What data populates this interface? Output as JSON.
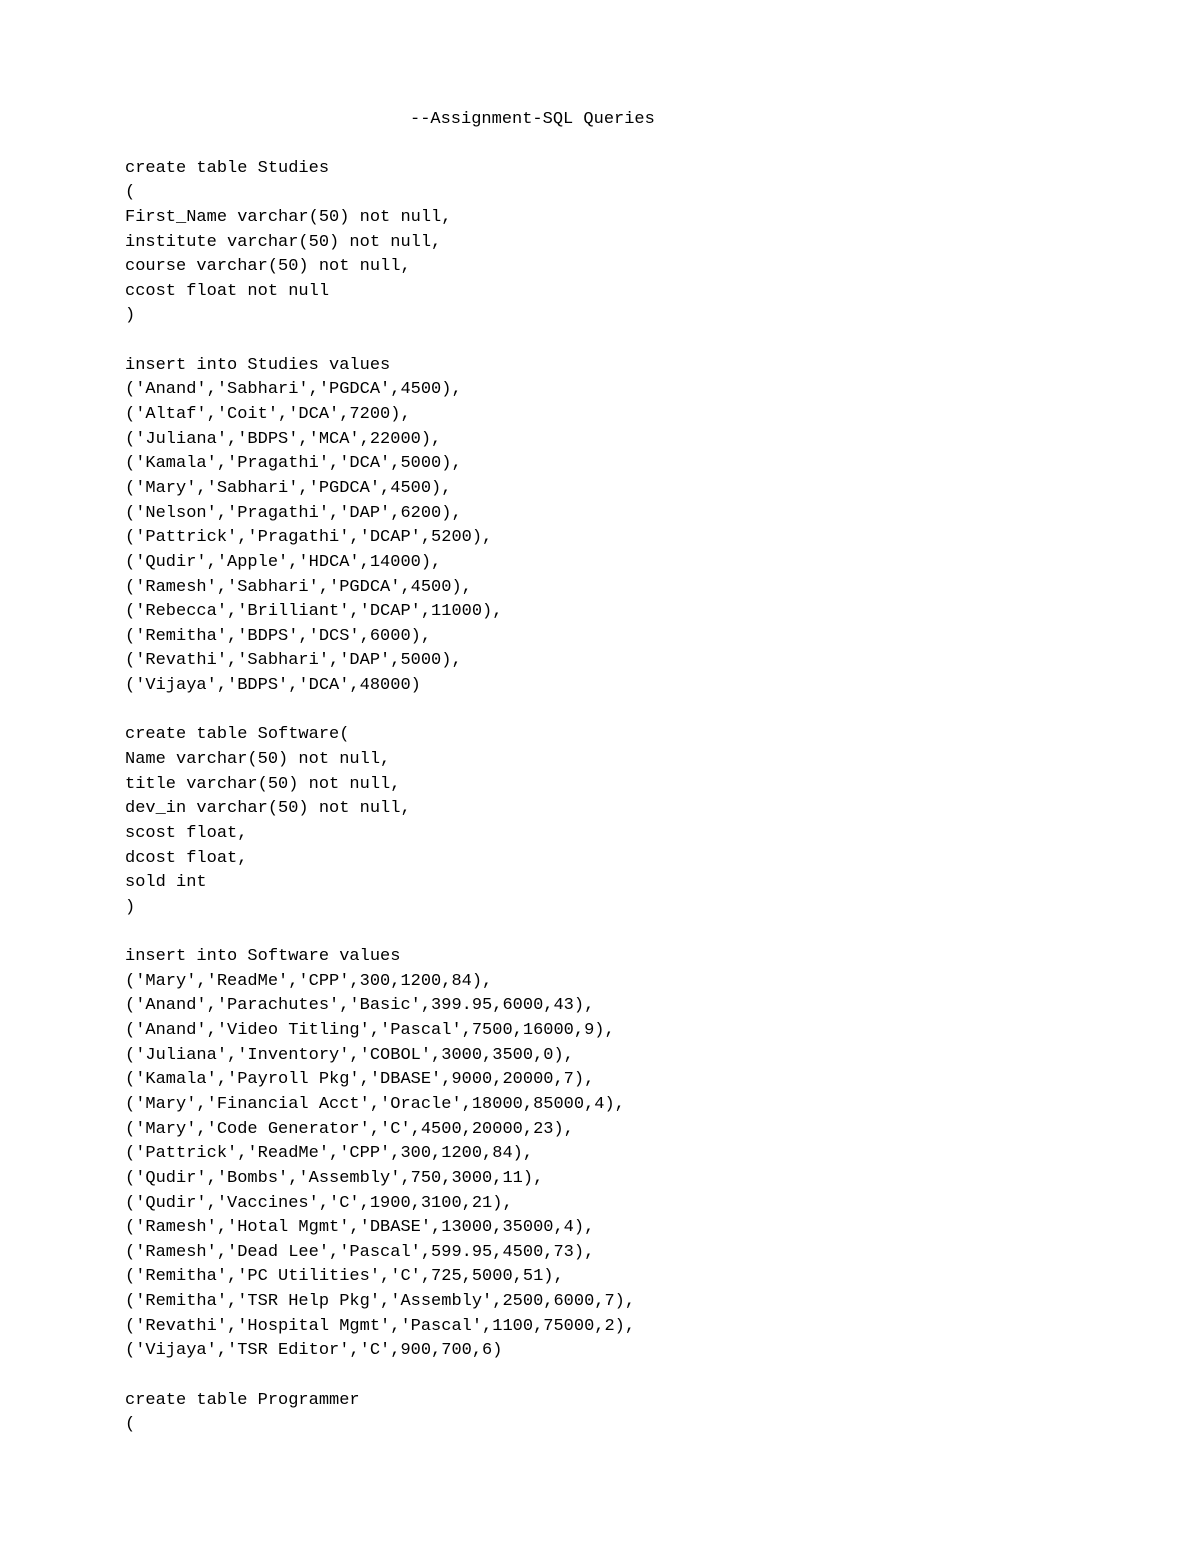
{
  "title": "--Assignment-SQL Queries",
  "sql": {
    "create_studies": "create table Studies\n(\nFirst_Name varchar(50) not null,\ninstitute varchar(50) not null,\ncourse varchar(50) not null,\nccost float not null\n)",
    "insert_studies": "insert into Studies values\n('Anand','Sabhari','PGDCA',4500),\n('Altaf','Coit','DCA',7200),\n('Juliana','BDPS','MCA',22000),\n('Kamala','Pragathi','DCA',5000),\n('Mary','Sabhari','PGDCA',4500),\n('Nelson','Pragathi','DAP',6200),\n('Pattrick','Pragathi','DCAP',5200),\n('Qudir','Apple','HDCA',14000),\n('Ramesh','Sabhari','PGDCA',4500),\n('Rebecca','Brilliant','DCAP',11000),\n('Remitha','BDPS','DCS',6000),\n('Revathi','Sabhari','DAP',5000),\n('Vijaya','BDPS','DCA',48000)",
    "create_software": "create table Software(\nName varchar(50) not null,\ntitle varchar(50) not null,\ndev_in varchar(50) not null,\nscost float,\ndcost float,\nsold int\n)",
    "insert_software": "insert into Software values\n('Mary','ReadMe','CPP',300,1200,84),\n('Anand','Parachutes','Basic',399.95,6000,43),\n('Anand','Video Titling','Pascal',7500,16000,9),\n('Juliana','Inventory','COBOL',3000,3500,0),\n('Kamala','Payroll Pkg','DBASE',9000,20000,7),\n('Mary','Financial Acct','Oracle',18000,85000,4),\n('Mary','Code Generator','C',4500,20000,23),\n('Pattrick','ReadMe','CPP',300,1200,84),\n('Qudir','Bombs','Assembly',750,3000,11),\n('Qudir','Vaccines','C',1900,3100,21),\n('Ramesh','Hotal Mgmt','DBASE',13000,35000,4),\n('Ramesh','Dead Lee','Pascal',599.95,4500,73),\n('Remitha','PC Utilities','C',725,5000,51),\n('Remitha','TSR Help Pkg','Assembly',2500,6000,7),\n('Revathi','Hospital Mgmt','Pascal',1100,75000,2),\n('Vijaya','TSR Editor','C',900,700,6)",
    "create_programmer": "create table Programmer\n("
  }
}
